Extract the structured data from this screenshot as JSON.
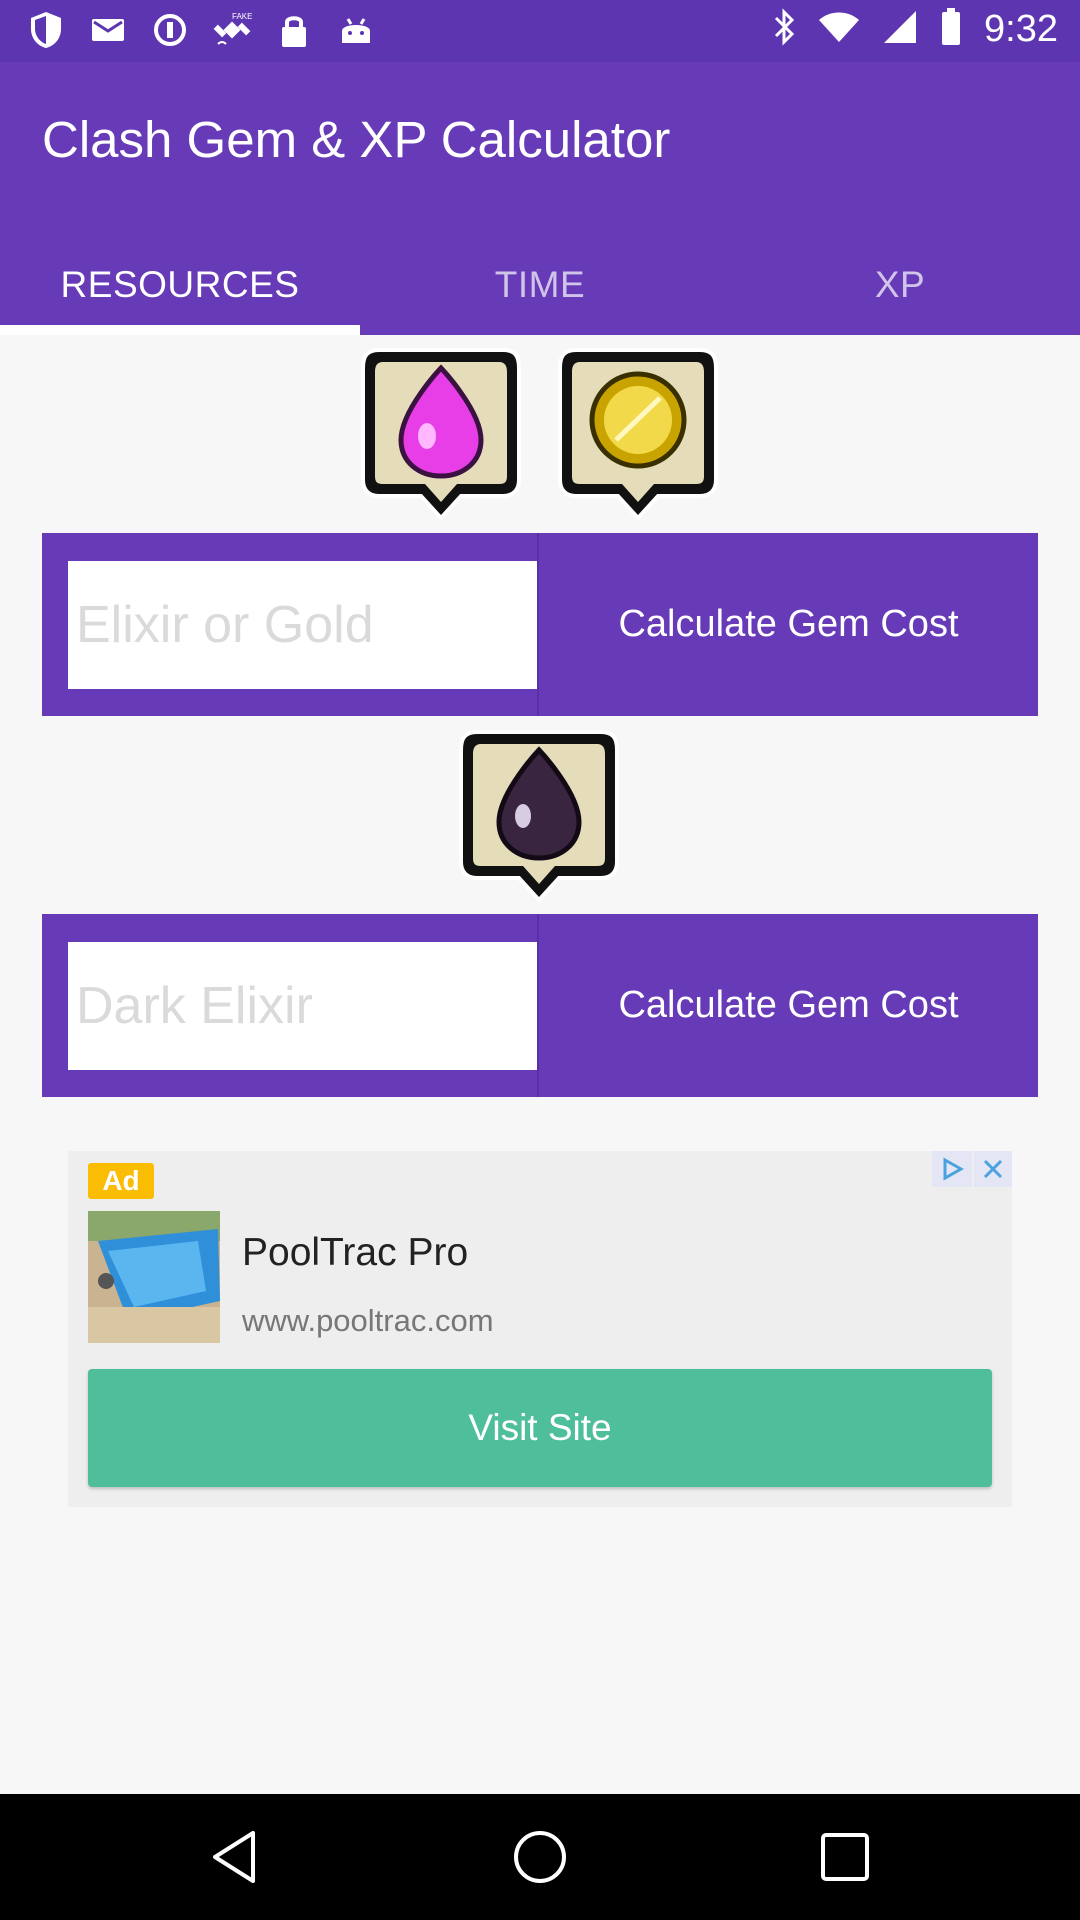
{
  "status_bar": {
    "time": "9:32",
    "left_icons": [
      "shield-icon",
      "mail-icon",
      "data-saver-icon",
      "fake-gps-icon",
      "lock-icon",
      "android-icon"
    ],
    "right_icons": [
      "bluetooth-icon",
      "wifi-icon",
      "cellular-icon",
      "battery-icon"
    ]
  },
  "app": {
    "title": "Clash Gem & XP Calculator",
    "colors": {
      "primary": "#673ab7",
      "primary_dark": "#5e35b1",
      "ad_button": "#4fbf9b",
      "ad_badge": "#fbbc04"
    }
  },
  "tabs": [
    {
      "label": "RESOURCES",
      "active": true
    },
    {
      "label": "TIME",
      "active": false
    },
    {
      "label": "XP",
      "active": false
    }
  ],
  "resources": {
    "icons": [
      "elixir-icon",
      "gold-icon",
      "dark-elixir-icon"
    ],
    "elixir_gold": {
      "placeholder": "Elixir or Gold",
      "value": "",
      "button_label": "Calculate Gem Cost"
    },
    "dark_elixir": {
      "placeholder": "Dark Elixir",
      "value": "",
      "button_label": "Calculate Gem Cost"
    }
  },
  "ad": {
    "badge": "Ad",
    "title": "PoolTrac Pro",
    "url": "www.pooltrac.com",
    "cta": "Visit Site"
  },
  "nav_bar": {
    "buttons": [
      "back-icon",
      "home-icon",
      "recents-icon"
    ]
  }
}
